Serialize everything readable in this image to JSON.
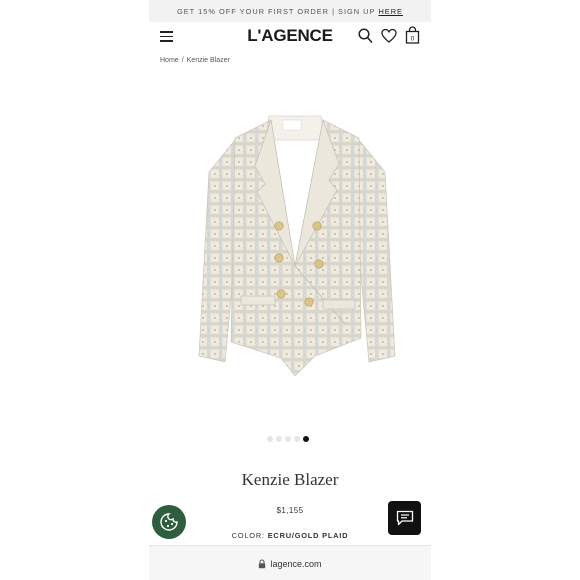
{
  "promo": {
    "text": "GET 15% OFF YOUR FIRST ORDER | SIGN UP",
    "link": "HERE"
  },
  "header": {
    "logo": "L'AGENCE",
    "icons": [
      "menu-icon",
      "search-icon",
      "heart-icon",
      "bag-icon"
    ],
    "bag_count": "0"
  },
  "breadcrumb": {
    "home": "Home",
    "separator": "/",
    "current": "Kenzie Blazer"
  },
  "gallery": {
    "total": 5,
    "active_index": 5
  },
  "product": {
    "title": "Kenzie Blazer",
    "price": "$1,155",
    "color_label": "COLOR:",
    "color_value": "ECRU/GOLD PLAID"
  },
  "browser": {
    "url": "lagence.com"
  },
  "colors": {
    "cookie_button": "#2e5e3e",
    "chat_button": "#111111",
    "promo_bg": "#f2f2f2"
  }
}
